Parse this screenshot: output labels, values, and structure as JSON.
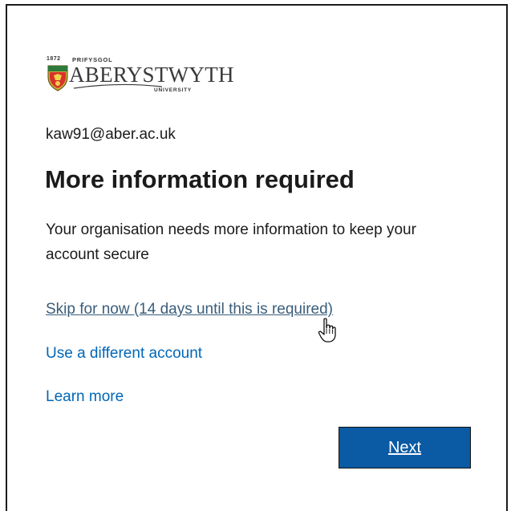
{
  "logo": {
    "year": "1872",
    "prefix": "PRIFYSGOL",
    "name": "ABERYSTWYTH",
    "suffix": "UNIVERSITY",
    "icon": "university-crest-icon"
  },
  "account": {
    "email": "kaw91@aber.ac.uk"
  },
  "heading": "More information required",
  "description": "Your organisation needs more information to keep your account secure",
  "links": {
    "skip": "Skip for now (14 days until this is required)",
    "different_account": "Use a different account",
    "learn_more": "Learn more"
  },
  "buttons": {
    "next": "Next"
  },
  "cursor": {
    "icon": "hand-pointer-icon"
  },
  "colors": {
    "link": "#0067b8",
    "button_bg": "#0b5aa4",
    "text": "#1b1b1b"
  }
}
